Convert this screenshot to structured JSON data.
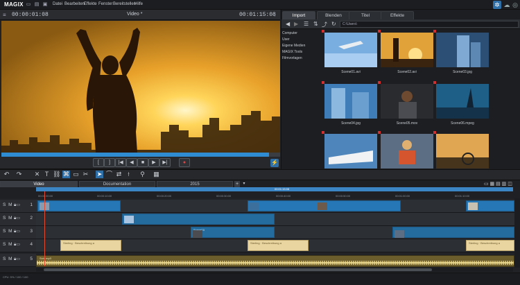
{
  "app": {
    "logo": "MAGIX"
  },
  "menu": {
    "items": [
      "Datei",
      "Bearbeiten",
      "Effekte",
      "Fenster",
      "Bereitstellen",
      "Hilfe"
    ]
  },
  "monitor": {
    "timecode_left": "00:00:01:08",
    "title": "Video *",
    "timecode_right": "00:01:15:08",
    "progress_fraction": 0.96
  },
  "transport": {
    "buttons": [
      "[",
      "]",
      "|◀",
      "◀",
      "■",
      "▶",
      "▶|",
      "●"
    ]
  },
  "media_pool": {
    "tabs": [
      "Import",
      "Blenden",
      "Titel",
      "Effekte"
    ],
    "path": "C:\\Users\\",
    "tree": [
      "Computer",
      "User",
      "Eigene Medien",
      "MAGIX Tools",
      "Filmvorlagen"
    ],
    "files": [
      "Scene01.avi",
      "Scene02.avi",
      "Scene03.jpg",
      "Scene04.jpg",
      "Scene05.mov",
      "Scene06.mpeg",
      "",
      "",
      ""
    ]
  },
  "project_tabs": [
    "Video",
    "Documentation",
    "2015"
  ],
  "ruler": {
    "ticks": [
      "00:00:00:00",
      "00:00:10:00",
      "00:00:20:00",
      "00:00:30:00",
      "00:00:40:00",
      "00:00:50:00",
      "00:01:00:00",
      "00:01:10:00"
    ],
    "bar_label": "00:01:15:08"
  },
  "tracks": [
    {
      "name": "S M",
      "num": "1"
    },
    {
      "name": "S M",
      "num": "2"
    },
    {
      "name": "S M",
      "num": "3"
    },
    {
      "name": "S M",
      "num": "4"
    },
    {
      "name": "S M",
      "num": "5"
    }
  ],
  "clips": {
    "title_text": "Sterling · Beschreibung a",
    "track3_label": "Scene03",
    "audio_label": "Solo.mp3"
  },
  "status": {
    "cpu": "CPU: 5% / 100 / 100"
  },
  "colors": {
    "accent": "#2f8cd3",
    "clip_blue": "#2578b5",
    "title_clip": "#e9d5a0",
    "audio": "#6b5e2c",
    "playhead": "#e14b2f"
  }
}
